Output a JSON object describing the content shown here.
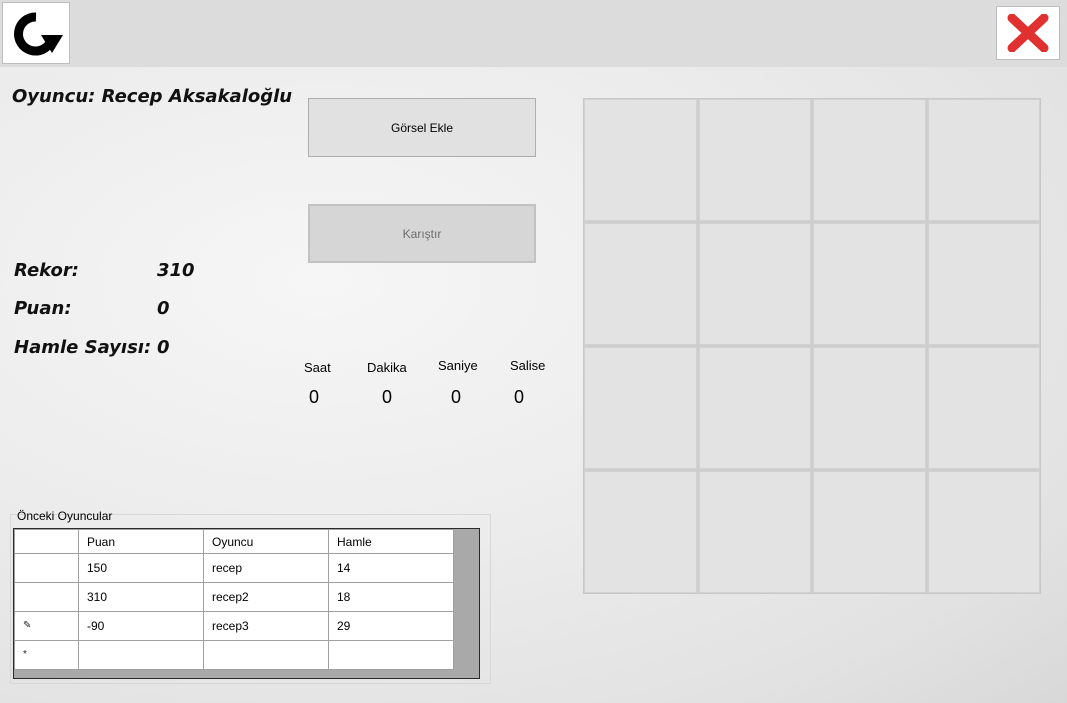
{
  "titlebar": {
    "refresh_icon": "refresh-icon",
    "close_icon": "close-icon"
  },
  "player": {
    "label": "Oyuncu: Recep Aksakaloğlu"
  },
  "buttons": {
    "add_image": "Görsel Ekle",
    "shuffle": "Karıştır"
  },
  "stats": {
    "record_label": "Rekor:",
    "record_value": "310",
    "score_label": "Puan:",
    "score_value": "0",
    "moves_label": "Hamle Sayısı:",
    "moves_value": "0"
  },
  "timer": {
    "hours_label": "Saat",
    "hours_value": "0",
    "minutes_label": "Dakika",
    "minutes_value": "0",
    "seconds_label": "Saniye",
    "seconds_value": "0",
    "centis_label": "Salise",
    "centis_value": "0"
  },
  "previous_players": {
    "title": "Önceki Oyuncular",
    "columns": [
      "Puan",
      "Oyuncu",
      "Hamle"
    ],
    "rows": [
      {
        "marker": "",
        "puan": "150",
        "oyuncu": "recep",
        "hamle": "14"
      },
      {
        "marker": "",
        "puan": "310",
        "oyuncu": "recep2",
        "hamle": "18"
      },
      {
        "marker": "✎",
        "puan": "-90",
        "oyuncu": "recep3",
        "hamle": "29"
      },
      {
        "marker": "*",
        "puan": "",
        "oyuncu": "",
        "hamle": ""
      }
    ]
  },
  "colors": {
    "close_red": "#e03030",
    "background": "#e8e8e8"
  }
}
